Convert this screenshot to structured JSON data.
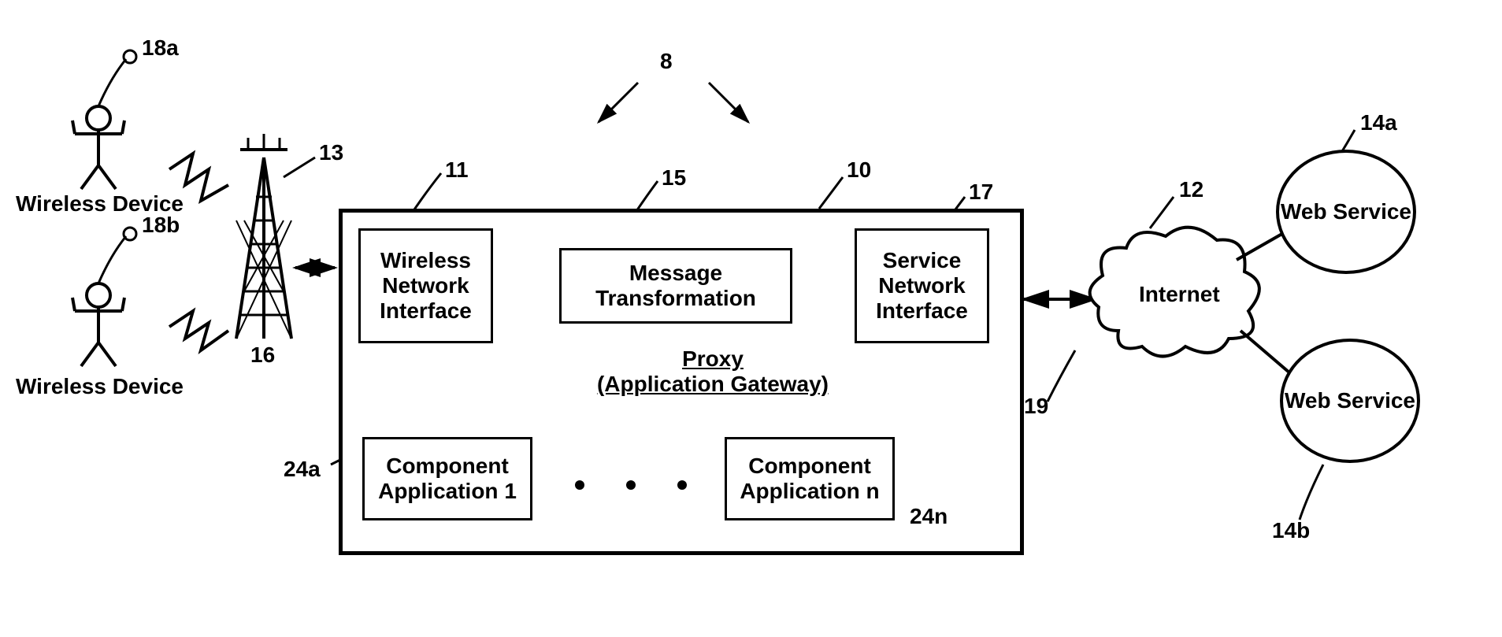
{
  "labels": {
    "n8": "8",
    "n10": "10",
    "n11": "11",
    "n12": "12",
    "n13": "13",
    "n14a": "14a",
    "n14b": "14b",
    "n15": "15",
    "n16": "16",
    "n17": "17",
    "n18a": "18a",
    "n18b": "18b",
    "n19": "19",
    "n24a": "24a",
    "n24n": "24n"
  },
  "text": {
    "wireless_device_a": "Wireless Device",
    "wireless_device_b": "Wireless Device",
    "wireless_network_interface": "Wireless Network Interface",
    "message_transformation": "Message Transformation",
    "service_network_interface": "Service Network Interface",
    "proxy_line1": "Proxy",
    "proxy_line2": "(Application Gateway)",
    "component_app_1": "Component Application 1",
    "component_app_n": "Component Application n",
    "internet": "Internet",
    "web_service_a": "Web Service",
    "web_service_b": "Web Service"
  }
}
